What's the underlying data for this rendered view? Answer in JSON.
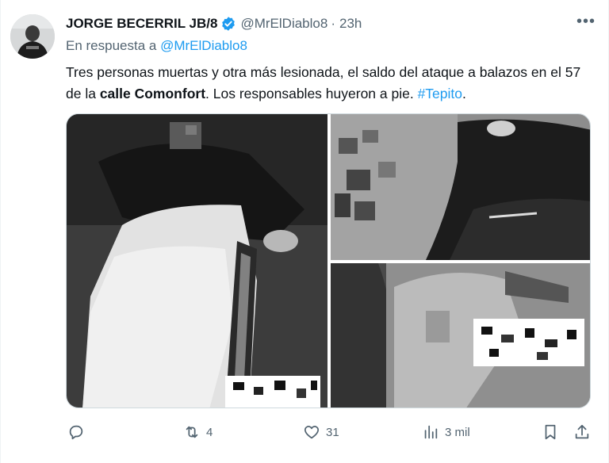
{
  "author": {
    "name": "JORGE BECERRIL JB/8",
    "handle": "@MrElDiablo8",
    "time": "23h",
    "verified_color": "#1d9bf0"
  },
  "reply_context": {
    "prefix": "En respuesta a",
    "mention": "@MrElDiablo8"
  },
  "tweet_text": {
    "part1": "Tres personas muertas y otra más lesionada, el saldo del ataque a balazos en el 57 de la ",
    "bold": "calle Comonfort",
    "part2": ". Los responsables huyeron a pie. ",
    "hashtag": "#Tepito",
    "part3": "."
  },
  "media": {
    "photos": [
      "photo-1",
      "photo-2",
      "photo-3"
    ]
  },
  "actions": {
    "reply": {
      "icon": "reply-icon",
      "count": ""
    },
    "retweet": {
      "icon": "retweet-icon",
      "count": "4"
    },
    "like": {
      "icon": "heart-icon",
      "count": "31"
    },
    "views": {
      "icon": "views-icon",
      "count": "3 mil"
    },
    "bookmark": {
      "icon": "bookmark-icon"
    },
    "share": {
      "icon": "share-icon"
    }
  },
  "colors": {
    "link": "#1d9bf0",
    "secondary_text": "#536471",
    "primary_text": "#0f1419"
  }
}
